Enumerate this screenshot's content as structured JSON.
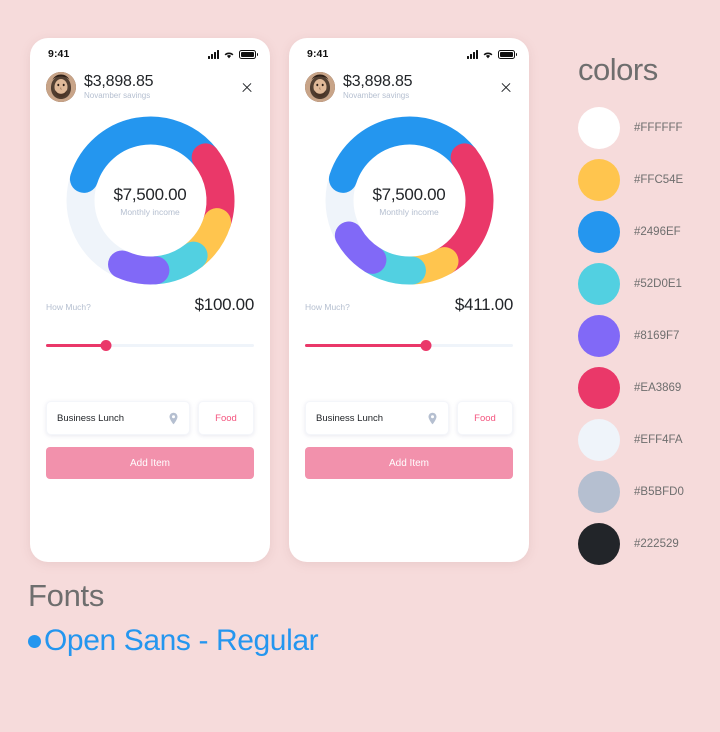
{
  "background_color": "#F6DBDB",
  "phones": [
    {
      "name": "phone-1",
      "status": {
        "time": "9:41",
        "signal_icon": "signal-bars-icon",
        "wifi_icon": "wifi-icon",
        "battery_icon": "battery-icon"
      },
      "header": {
        "avatar_icon": "user-avatar",
        "amount": "$3,898.85",
        "subtitle": "Novamber savings",
        "close_icon": "close-icon"
      },
      "donut": {
        "center_value": "$7,500.00",
        "center_label": "Monthly income",
        "track_color": "#EFF4FA",
        "segments": [
          {
            "name": "blue",
            "color": "#2496EF",
            "start": -72,
            "end": 52
          },
          {
            "name": "pink",
            "color": "#EA3869",
            "start": 52,
            "end": 108
          },
          {
            "name": "yellow",
            "color": "#FFC54E",
            "start": 108,
            "end": 142
          },
          {
            "name": "cyan",
            "color": "#52D0E1",
            "start": 142,
            "end": 176
          },
          {
            "name": "purple",
            "color": "#8169F7",
            "start": 176,
            "end": 204
          }
        ]
      },
      "how_much": {
        "label": "How Much?",
        "value": "$100.00"
      },
      "slider": {
        "percent": 29,
        "fill_color": "#EA3869",
        "track_color": "#EFF4FA"
      },
      "inputs": {
        "text_value": "Business Lunch",
        "text_placeholder": "Business Lunch",
        "pin_icon": "location-pin-icon",
        "tag_label": "Food"
      },
      "add_button": {
        "label": "Add Item",
        "color": "#F291AC"
      }
    },
    {
      "name": "phone-2",
      "status": {
        "time": "9:41",
        "signal_icon": "signal-bars-icon",
        "wifi_icon": "wifi-icon",
        "battery_icon": "battery-icon"
      },
      "header": {
        "avatar_icon": "user-avatar",
        "amount": "$3,898.85",
        "subtitle": "Novamber savings",
        "close_icon": "close-icon"
      },
      "donut": {
        "center_value": "$7,500.00",
        "center_label": "Monthly income",
        "track_color": "#EFF4FA",
        "segments": [
          {
            "name": "blue",
            "color": "#2496EF",
            "start": -72,
            "end": 52
          },
          {
            "name": "pink",
            "color": "#EA3869",
            "start": 52,
            "end": 150
          },
          {
            "name": "yellow",
            "color": "#FFC54E",
            "start": 150,
            "end": 178
          },
          {
            "name": "cyan",
            "color": "#52D0E1",
            "start": 178,
            "end": 212
          },
          {
            "name": "purple",
            "color": "#8169F7",
            "start": 212,
            "end": 240
          }
        ]
      },
      "how_much": {
        "label": "How Much?",
        "value": "$411.00"
      },
      "slider": {
        "percent": 58,
        "fill_color": "#EA3869",
        "track_color": "#EFF4FA"
      },
      "inputs": {
        "text_value": "Business Lunch",
        "text_placeholder": "Business Lunch",
        "pin_icon": "location-pin-icon",
        "tag_label": "Food"
      },
      "add_button": {
        "label": "Add Item",
        "color": "#F291AC"
      }
    }
  ],
  "colors": {
    "title": "colors",
    "swatches": [
      {
        "hex": "#FFFFFF"
      },
      {
        "hex": "#FFC54E"
      },
      {
        "hex": "#2496EF"
      },
      {
        "hex": "#52D0E1"
      },
      {
        "hex": "#8169F7"
      },
      {
        "hex": "#EA3869"
      },
      {
        "hex": "#EFF4FA"
      },
      {
        "hex": "#B5BFD0"
      },
      {
        "hex": "#222529"
      }
    ]
  },
  "fonts": {
    "title": "Fonts",
    "items": [
      {
        "name": "Open Sans - Regular",
        "bullet_color": "#2496EF"
      }
    ]
  }
}
